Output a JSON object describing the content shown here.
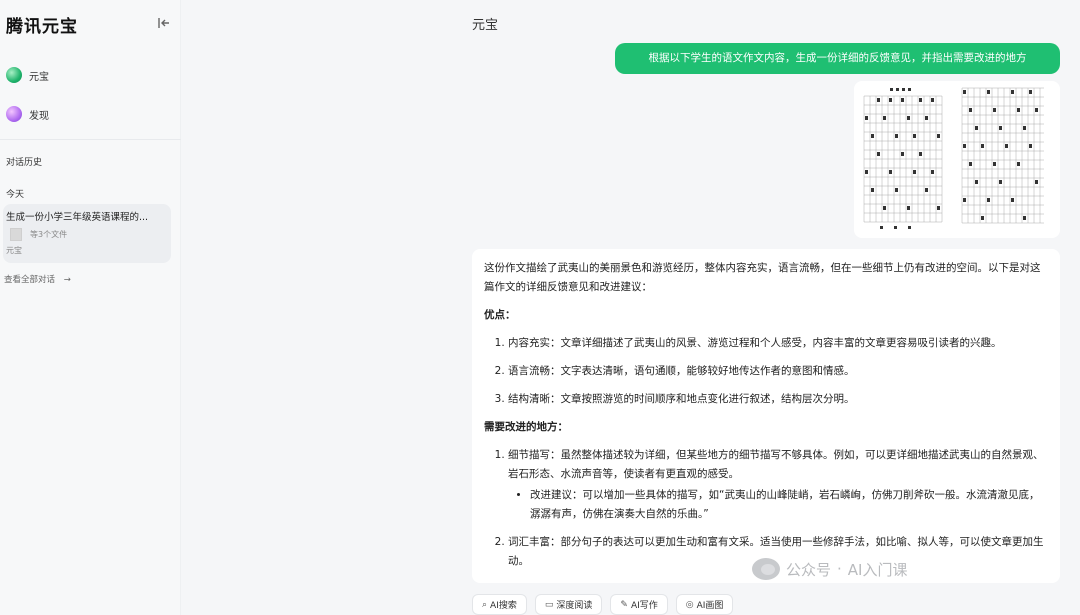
{
  "sidebar": {
    "brand": "腾讯元宝",
    "collapse_icon": "collapse-left-icon",
    "nav": [
      {
        "label": "元宝",
        "icon": "yuanbao-logo-icon"
      },
      {
        "label": "发现",
        "icon": "discover-icon"
      }
    ],
    "history_label": "对话历史",
    "today_label": "今天",
    "history_item": {
      "title": "生成一份小学三年级英语课程的...",
      "files": "等3个文件",
      "source": "元宝"
    },
    "view_all": "查看全部对话"
  },
  "main": {
    "title": "元宝",
    "user_message": "根据以下学生的语文作文内容，生成一份详细的反馈意见，并指出需要改进的地方",
    "answer": {
      "intro": "这份作文描绘了武夷山的美丽景色和游览经历，整体内容充实，语言流畅，但在一些细节上仍有改进的空间。以下是对这篇作文的详细反馈意见和改进建议：",
      "strengths_title": "优点：",
      "strengths": [
        "内容充实：文章详细描述了武夷山的风景、游览过程和个人感受，内容丰富的文章更容易吸引读者的兴趣。",
        "语言流畅：文字表达清晰，语句通顺，能够较好地传达作者的意图和情感。",
        "结构清晰：文章按照游览的时间顺序和地点变化进行叙述，结构层次分明。"
      ],
      "improve_title": "需要改进的地方：",
      "improvements": [
        {
          "text": "细节描写：虽然整体描述较为详细，但某些地方的细节描写不够具体。例如，可以更详细地描述武夷山的自然景观、岩石形态、水流声音等，使读者有更直观的感受。",
          "sub": "改进建议：可以增加一些具体的描写，如“武夷山的山峰陡峭，岩石嶙峋，仿佛刀削斧砍一般。水流清澈见底，潺潺有声，仿佛在演奏大自然的乐曲。”"
        },
        {
          "text": "词汇丰富：部分句子的表达可以更加生动和富有文采。适当使用一些修辞手法，如比喻、拟人等，可以使文章更加生动。"
        }
      ]
    },
    "toolbar": [
      {
        "label": "AI搜索",
        "icon": "search-icon"
      },
      {
        "label": "深度阅读",
        "icon": "book-icon"
      },
      {
        "label": "AI写作",
        "icon": "pen-icon"
      },
      {
        "label": "AI画图",
        "icon": "palette-icon"
      }
    ]
  },
  "watermark": {
    "left": "公众号",
    "right": "AI入门课"
  },
  "colors": {
    "accent": "#1fbf72",
    "sidebar_bg": "#f7f8f9",
    "main_bg": "#f5f6f8"
  }
}
